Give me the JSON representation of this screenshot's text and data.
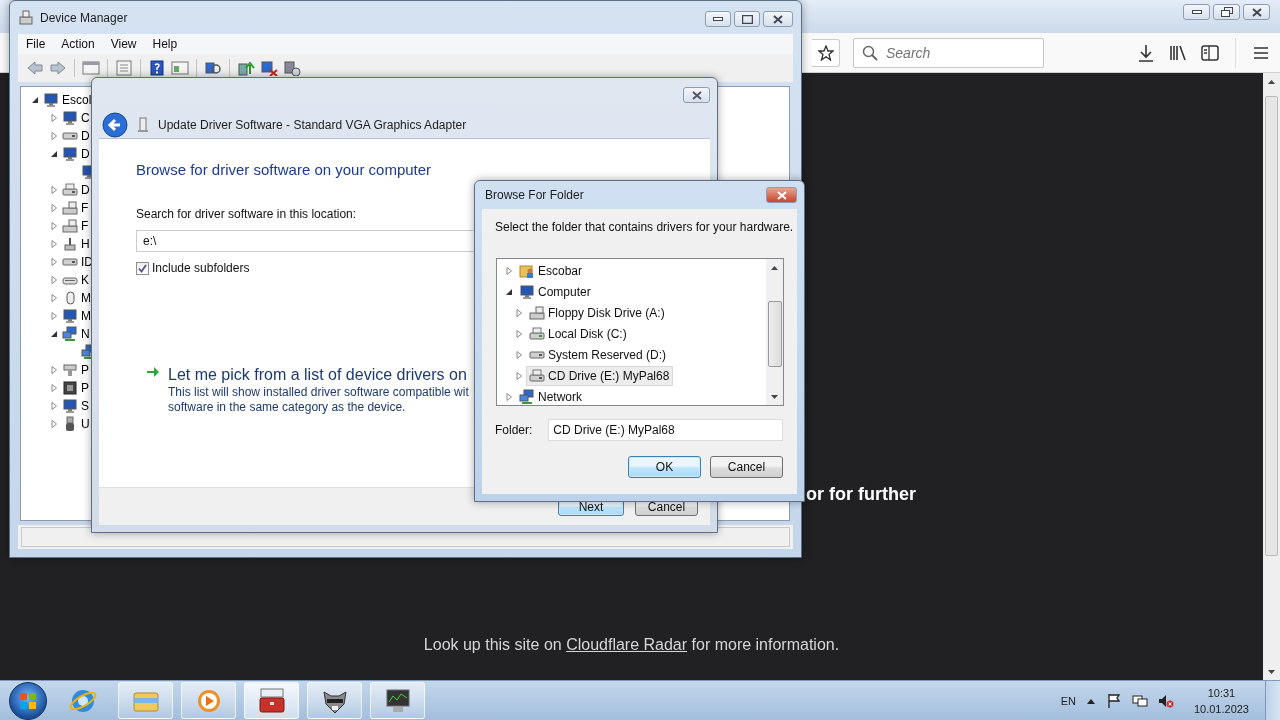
{
  "browser": {
    "search": {
      "placeholder": "Search"
    },
    "page": {
      "fragment": "or for further",
      "footer": {
        "before": "Look up this site on ",
        "link": "Cloudflare Radar",
        "after": " for more information."
      }
    }
  },
  "device_manager": {
    "title": "Device Manager",
    "menu": [
      "File",
      "Action",
      "View",
      "Help"
    ],
    "tree": {
      "label": "Escol",
      "kind": "computer",
      "expanded": true,
      "children": [
        {
          "label": "C",
          "kind": "computer",
          "expanded": false
        },
        {
          "label": "D",
          "kind": "drive",
          "expanded": false
        },
        {
          "label": "D",
          "kind": "display",
          "expanded": true,
          "children": [
            {
              "kind": "display"
            }
          ]
        },
        {
          "label": "D",
          "kind": "optical",
          "expanded": false
        },
        {
          "label": "F",
          "kind": "floppy",
          "expanded": false
        },
        {
          "label": "F",
          "kind": "floppy",
          "expanded": false
        },
        {
          "label": "H",
          "kind": "hid",
          "expanded": false
        },
        {
          "label": "ID",
          "kind": "drive",
          "expanded": false
        },
        {
          "label": "K",
          "kind": "keyboard",
          "expanded": false
        },
        {
          "label": "M",
          "kind": "mouse",
          "expanded": false
        },
        {
          "label": "M",
          "kind": "display",
          "expanded": false
        },
        {
          "label": "N",
          "kind": "network",
          "expanded": true,
          "children": [
            {
              "kind": "network"
            }
          ]
        },
        {
          "label": "P",
          "kind": "port",
          "expanded": false
        },
        {
          "label": "P",
          "kind": "chip",
          "expanded": false
        },
        {
          "label": "S",
          "kind": "computer",
          "expanded": false
        },
        {
          "label": "U",
          "kind": "usb",
          "expanded": false
        }
      ]
    }
  },
  "update_driver": {
    "title": "Update Driver Software - Standard VGA Graphics Adapter",
    "heading": "Browse for driver software on your computer",
    "location_label": "Search for driver software in this location:",
    "location": {
      "value": "e:\\"
    },
    "include_subfolders": {
      "label": "Include subfolders",
      "checked": true
    },
    "pick_option": {
      "title": "Let me pick from a list of device drivers on",
      "description": [
        "This list will show installed driver software compatible wit",
        "software in the same category as the device."
      ]
    },
    "buttons": [
      "Next",
      "Cancel"
    ]
  },
  "browse_folder": {
    "title": "Browse For Folder",
    "instruction": "Select the folder that contains drivers for your hardware.",
    "tree": [
      {
        "label": "Escobar",
        "kind": "user",
        "expanded": false,
        "selected": false
      },
      {
        "label": "Computer",
        "kind": "computer",
        "expanded": true,
        "selected": false,
        "children": [
          {
            "label": "Floppy Disk Drive (A:)",
            "kind": "floppy",
            "expanded": false,
            "selected": false
          },
          {
            "label": "Local Disk (C:)",
            "kind": "system",
            "expanded": false,
            "selected": false
          },
          {
            "label": "System Reserved (D:)",
            "kind": "drive",
            "expanded": false,
            "selected": false
          },
          {
            "label": "CD Drive (E:) MyPal68",
            "kind": "optical",
            "expanded": false,
            "selected": true
          }
        ]
      },
      {
        "label": "Network",
        "kind": "network",
        "expanded": false,
        "selected": false
      }
    ],
    "folder_label": "Folder:",
    "folder": {
      "value": "CD Drive (E:) MyPal68"
    },
    "buttons": [
      {
        "label": "OK",
        "default": true
      },
      {
        "label": "Cancel",
        "default": false
      }
    ]
  },
  "taskbar": {
    "apps": [
      {
        "kind": "ie",
        "active": false
      },
      {
        "kind": "explorer",
        "active": false
      },
      {
        "kind": "media",
        "active": false
      },
      {
        "kind": "toolbox",
        "active": true
      },
      {
        "kind": "raccoon",
        "active": false
      },
      {
        "kind": "monitor",
        "active": false
      }
    ],
    "language": "EN",
    "time": "10:31",
    "date": "10.01.2023"
  }
}
